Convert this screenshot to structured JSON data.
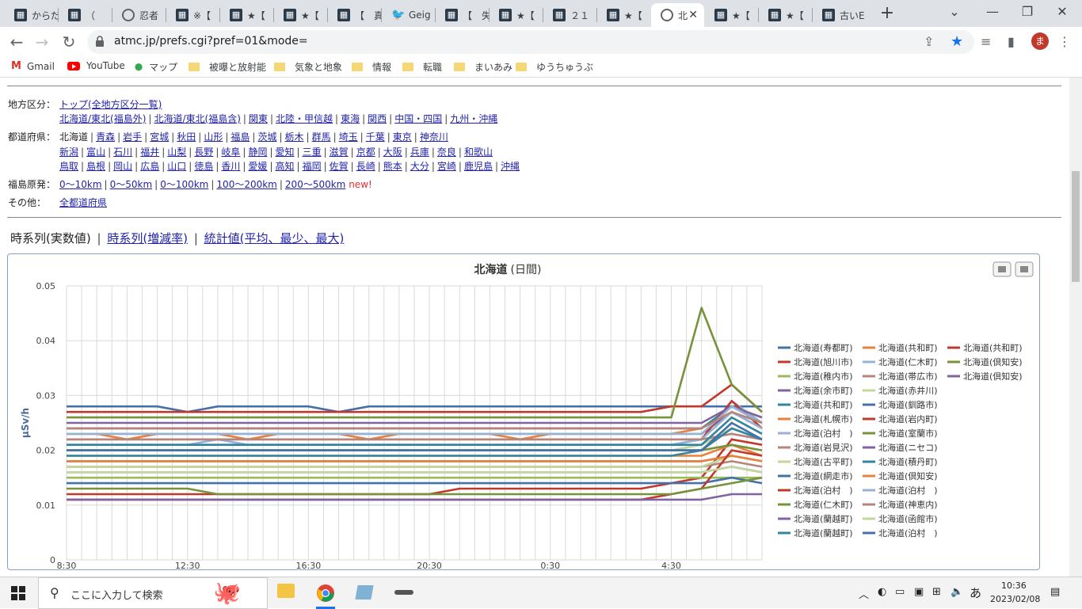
{
  "browser": {
    "tabs": [
      {
        "label": "からだ",
        "icon": "dark-favicon-icon"
      },
      {
        "label": "（",
        "icon": "dark-favicon-icon"
      },
      {
        "label": "忍者",
        "icon": "globe-icon"
      },
      {
        "label": "※【",
        "icon": "dark-favicon-icon"
      },
      {
        "label": "★【",
        "icon": "dark-favicon-icon"
      },
      {
        "label": "★【",
        "icon": "dark-favicon-icon"
      },
      {
        "label": "【　真",
        "icon": "dark-favicon-icon"
      },
      {
        "label": "Geig",
        "icon": "twitter-icon"
      },
      {
        "label": "【　失",
        "icon": "dark-favicon-icon"
      },
      {
        "label": "★【",
        "icon": "dark-favicon-icon"
      },
      {
        "label": "２１",
        "icon": "dark-favicon-icon"
      },
      {
        "label": "★【",
        "icon": "dark-favicon-icon"
      },
      {
        "label": "北",
        "icon": "globe-icon",
        "active": true
      },
      {
        "label": "★【",
        "icon": "dark-favicon-icon"
      },
      {
        "label": "★【",
        "icon": "dark-favicon-icon"
      },
      {
        "label": "古いE",
        "icon": "dark-favicon-icon"
      }
    ],
    "new_tab": "+",
    "url": "atmc.jp/prefs.cgi?pref=01&mode=",
    "avatar_letter": "ま",
    "bookmarks": [
      {
        "label": "Gmail",
        "type": "gmail"
      },
      {
        "label": "YouTube",
        "type": "youtube"
      },
      {
        "label": "マップ",
        "type": "maps"
      },
      {
        "label": "被曝と放射能",
        "type": "folder"
      },
      {
        "label": "気象と地象",
        "type": "folder"
      },
      {
        "label": "情報",
        "type": "folder"
      },
      {
        "label": "転職",
        "type": "folder"
      },
      {
        "label": "まいあみ",
        "type": "folder"
      },
      {
        "label": "ゆうちゅうぶ",
        "type": "folder"
      }
    ]
  },
  "nav": {
    "region_label": "地方区分：",
    "region_top": "トップ(全地方区分一覧)",
    "regions": [
      "北海道/東北(福島外)",
      "北海道/東北(福島含)",
      "関東",
      "北陸・甲信越",
      "東海",
      "関西",
      "中国・四国",
      "九州・沖縄"
    ],
    "pref_label": "都道府県：",
    "pref_current": "北海道",
    "prefs_row1": [
      "青森",
      "岩手",
      "宮城",
      "秋田",
      "山形",
      "福島",
      "茨城",
      "栃木",
      "群馬",
      "埼玉",
      "千葉",
      "東京",
      "神奈川"
    ],
    "prefs_row2": [
      "新潟",
      "富山",
      "石川",
      "福井",
      "山梨",
      "長野",
      "岐阜",
      "静岡",
      "愛知",
      "三重",
      "滋賀",
      "京都",
      "大阪",
      "兵庫",
      "奈良",
      "和歌山"
    ],
    "prefs_row3": [
      "鳥取",
      "島根",
      "岡山",
      "広島",
      "山口",
      "徳島",
      "香川",
      "愛媛",
      "高知",
      "福岡",
      "佐賀",
      "長崎",
      "熊本",
      "大分",
      "宮崎",
      "鹿児島",
      "沖縄"
    ],
    "fukushima_label": "福島原発：",
    "fukushima": [
      "0〜10km",
      "0〜50km",
      "0〜100km",
      "100〜200km",
      "200〜500km"
    ],
    "new_badge": "new!",
    "other_label": "その他：",
    "other_link": "全都道府県"
  },
  "view_tabs": {
    "current": "時系列(実数値)",
    "rate": "時系列(増減率)",
    "stats": "統計値(平均、最少、最大)"
  },
  "chart_data": {
    "type": "line",
    "title": "北海道 (日間)",
    "title_bold": "北海道",
    "title_rest": "(日間)",
    "ylabel": "μSv/h",
    "xlabel": "",
    "ylim": [
      0,
      0.05
    ],
    "yticks": [
      "0",
      "0.01",
      "0.02",
      "0.03",
      "0.04",
      "0.05"
    ],
    "xticks": [
      "8:30",
      "12:30",
      "16:30",
      "20:30",
      "0:30",
      "4:30"
    ],
    "grid": true,
    "legend_position": "right",
    "x": [
      "8:30",
      "9:30",
      "10:30",
      "11:30",
      "12:30",
      "13:30",
      "14:30",
      "15:30",
      "16:30",
      "17:30",
      "18:30",
      "19:30",
      "20:30",
      "21:30",
      "22:30",
      "23:30",
      "0:30",
      "1:30",
      "2:30",
      "3:30",
      "4:30",
      "5:30",
      "6:30",
      "7:30"
    ],
    "series": [
      {
        "name": "北海道(寿都町)",
        "color": "#4472a8",
        "values": [
          0.028,
          0.028,
          0.028,
          0.028,
          0.027,
          0.028,
          0.028,
          0.028,
          0.028,
          0.027,
          0.028,
          0.028,
          0.028,
          0.028,
          0.028,
          0.028,
          0.028,
          0.028,
          0.028,
          0.028,
          0.028,
          0.028,
          0.028,
          0.028
        ]
      },
      {
        "name": "北海道(共和町)",
        "color": "#e8823a",
        "values": [
          0.023,
          0.023,
          0.022,
          0.023,
          0.023,
          0.023,
          0.022,
          0.023,
          0.023,
          0.023,
          0.022,
          0.023,
          0.023,
          0.023,
          0.023,
          0.022,
          0.023,
          0.023,
          0.023,
          0.023,
          0.023,
          0.024,
          0.028,
          0.026
        ]
      },
      {
        "name": "北海道(共和町)",
        "color": "#c0392b",
        "values": [
          0.027,
          0.027,
          0.027,
          0.027,
          0.027,
          0.027,
          0.027,
          0.027,
          0.027,
          0.027,
          0.027,
          0.027,
          0.027,
          0.027,
          0.027,
          0.027,
          0.027,
          0.027,
          0.027,
          0.027,
          0.028,
          0.028,
          0.032,
          0.027
        ]
      },
      {
        "name": "北海道(旭川市)",
        "color": "#c0392b",
        "values": [
          0.012,
          0.012,
          0.012,
          0.012,
          0.012,
          0.012,
          0.012,
          0.012,
          0.012,
          0.012,
          0.012,
          0.012,
          0.012,
          0.013,
          0.013,
          0.013,
          0.013,
          0.013,
          0.013,
          0.013,
          0.014,
          0.015,
          0.022,
          0.021
        ]
      },
      {
        "name": "北海道(仁木町)",
        "color": "#95b3d7",
        "values": [
          0.021,
          0.021,
          0.021,
          0.021,
          0.021,
          0.022,
          0.021,
          0.021,
          0.021,
          0.021,
          0.021,
          0.021,
          0.021,
          0.021,
          0.021,
          0.021,
          0.021,
          0.021,
          0.021,
          0.021,
          0.021,
          0.022,
          0.029,
          0.025
        ]
      },
      {
        "name": "北海道(倶知安)",
        "color": "#76933c",
        "values": [
          0.026,
          0.026,
          0.026,
          0.026,
          0.026,
          0.026,
          0.026,
          0.026,
          0.026,
          0.026,
          0.026,
          0.026,
          0.026,
          0.026,
          0.026,
          0.026,
          0.026,
          0.026,
          0.026,
          0.026,
          0.026,
          0.046,
          0.032,
          0.027
        ]
      },
      {
        "name": "北海道(稚内市)",
        "color": "#9bbb59",
        "values": [
          0.015,
          0.015,
          0.015,
          0.015,
          0.015,
          0.015,
          0.015,
          0.015,
          0.015,
          0.015,
          0.015,
          0.015,
          0.015,
          0.015,
          0.015,
          0.015,
          0.015,
          0.015,
          0.015,
          0.015,
          0.015,
          0.015,
          0.015,
          0.015
        ]
      },
      {
        "name": "北海道(帯広市)",
        "color": "#b7847c",
        "values": [
          0.017,
          0.017,
          0.017,
          0.017,
          0.017,
          0.017,
          0.017,
          0.017,
          0.017,
          0.017,
          0.017,
          0.017,
          0.017,
          0.017,
          0.017,
          0.017,
          0.017,
          0.017,
          0.017,
          0.017,
          0.017,
          0.017,
          0.018,
          0.017
        ]
      },
      {
        "name": "北海道(倶知安)",
        "color": "#8064a2",
        "values": [
          0.023,
          0.023,
          0.023,
          0.023,
          0.023,
          0.023,
          0.023,
          0.023,
          0.023,
          0.023,
          0.023,
          0.023,
          0.023,
          0.023,
          0.023,
          0.023,
          0.023,
          0.023,
          0.023,
          0.023,
          0.023,
          0.023,
          0.027,
          0.024
        ]
      },
      {
        "name": "北海道(余市町)",
        "color": "#8064a2",
        "values": [
          0.018,
          0.018,
          0.018,
          0.018,
          0.018,
          0.018,
          0.018,
          0.018,
          0.018,
          0.018,
          0.018,
          0.018,
          0.018,
          0.018,
          0.018,
          0.018,
          0.018,
          0.018,
          0.018,
          0.018,
          0.018,
          0.018,
          0.019,
          0.018
        ]
      },
      {
        "name": "北海道(赤井川)",
        "color": "#c4d79b",
        "values": [
          0.02,
          0.02,
          0.02,
          0.02,
          0.02,
          0.02,
          0.02,
          0.02,
          0.02,
          0.02,
          0.02,
          0.02,
          0.02,
          0.02,
          0.02,
          0.02,
          0.02,
          0.02,
          0.02,
          0.02,
          0.02,
          0.021,
          0.024,
          0.022
        ]
      },
      {
        "name": "北海道(共和町)",
        "color": "#31859c",
        "values": [
          0.024,
          0.024,
          0.024,
          0.024,
          0.024,
          0.024,
          0.024,
          0.024,
          0.024,
          0.024,
          0.024,
          0.024,
          0.024,
          0.024,
          0.024,
          0.024,
          0.024,
          0.024,
          0.024,
          0.024,
          0.024,
          0.024,
          0.028,
          0.025
        ]
      },
      {
        "name": "北海道(釧路市)",
        "color": "#4472a8",
        "values": [
          0.014,
          0.014,
          0.014,
          0.014,
          0.014,
          0.014,
          0.014,
          0.014,
          0.014,
          0.014,
          0.014,
          0.014,
          0.014,
          0.014,
          0.014,
          0.014,
          0.014,
          0.014,
          0.014,
          0.014,
          0.014,
          0.014,
          0.015,
          0.014
        ]
      },
      {
        "name": "北海道(札幌市)",
        "color": "#e8823a",
        "values": [
          0.019,
          0.019,
          0.019,
          0.019,
          0.019,
          0.019,
          0.019,
          0.019,
          0.019,
          0.019,
          0.019,
          0.019,
          0.019,
          0.019,
          0.019,
          0.019,
          0.019,
          0.019,
          0.019,
          0.019,
          0.019,
          0.019,
          0.021,
          0.019
        ]
      },
      {
        "name": "北海道(岩内町)",
        "color": "#c0392b",
        "values": [
          0.022,
          0.022,
          0.022,
          0.022,
          0.022,
          0.022,
          0.022,
          0.022,
          0.022,
          0.022,
          0.022,
          0.022,
          0.022,
          0.022,
          0.022,
          0.022,
          0.022,
          0.022,
          0.022,
          0.022,
          0.022,
          0.022,
          0.029,
          0.024
        ]
      },
      {
        "name": "北海道(泊村　)",
        "color": "#95b3d7",
        "values": [
          0.021,
          0.021,
          0.021,
          0.021,
          0.021,
          0.021,
          0.021,
          0.021,
          0.021,
          0.021,
          0.021,
          0.021,
          0.021,
          0.021,
          0.021,
          0.021,
          0.021,
          0.021,
          0.021,
          0.021,
          0.021,
          0.022,
          0.027,
          0.024
        ]
      },
      {
        "name": "北海道(室蘭市)",
        "color": "#76933c",
        "values": [
          0.02,
          0.02,
          0.02,
          0.02,
          0.02,
          0.02,
          0.02,
          0.02,
          0.02,
          0.02,
          0.02,
          0.02,
          0.02,
          0.02,
          0.02,
          0.02,
          0.02,
          0.02,
          0.02,
          0.02,
          0.02,
          0.02,
          0.021,
          0.02
        ]
      },
      {
        "name": "北海道(岩見沢)",
        "color": "#b7847c",
        "values": [
          0.022,
          0.022,
          0.022,
          0.022,
          0.022,
          0.022,
          0.022,
          0.022,
          0.022,
          0.022,
          0.022,
          0.022,
          0.022,
          0.022,
          0.022,
          0.022,
          0.022,
          0.022,
          0.022,
          0.022,
          0.022,
          0.022,
          0.023,
          0.022
        ]
      },
      {
        "name": "北海道(ニセコ)",
        "color": "#8064a2",
        "values": [
          0.025,
          0.025,
          0.025,
          0.025,
          0.025,
          0.025,
          0.025,
          0.025,
          0.025,
          0.025,
          0.025,
          0.025,
          0.025,
          0.025,
          0.025,
          0.025,
          0.025,
          0.025,
          0.025,
          0.025,
          0.025,
          0.025,
          0.028,
          0.026
        ]
      },
      {
        "name": "北海道(古平町)",
        "color": "#c4d79b",
        "values": [
          0.017,
          0.017,
          0.017,
          0.017,
          0.017,
          0.017,
          0.017,
          0.017,
          0.017,
          0.017,
          0.017,
          0.017,
          0.017,
          0.017,
          0.017,
          0.017,
          0.017,
          0.017,
          0.017,
          0.017,
          0.017,
          0.017,
          0.019,
          0.018
        ]
      },
      {
        "name": "北海道(積丹町)",
        "color": "#31859c",
        "values": [
          0.021,
          0.021,
          0.021,
          0.021,
          0.021,
          0.021,
          0.021,
          0.021,
          0.021,
          0.021,
          0.021,
          0.021,
          0.021,
          0.021,
          0.021,
          0.021,
          0.021,
          0.021,
          0.021,
          0.021,
          0.021,
          0.021,
          0.026,
          0.023
        ]
      },
      {
        "name": "北海道(網走市)",
        "color": "#4472a8",
        "values": [
          0.016,
          0.016,
          0.016,
          0.016,
          0.016,
          0.016,
          0.016,
          0.016,
          0.016,
          0.016,
          0.016,
          0.016,
          0.016,
          0.016,
          0.016,
          0.016,
          0.016,
          0.016,
          0.016,
          0.016,
          0.016,
          0.016,
          0.017,
          0.016
        ]
      },
      {
        "name": "北海道(倶知安)",
        "color": "#e8823a",
        "values": [
          0.018,
          0.018,
          0.018,
          0.018,
          0.018,
          0.018,
          0.018,
          0.018,
          0.018,
          0.018,
          0.018,
          0.018,
          0.018,
          0.018,
          0.018,
          0.018,
          0.018,
          0.018,
          0.018,
          0.018,
          0.018,
          0.018,
          0.019,
          0.018
        ]
      },
      {
        "name": "北海道(泊村　)",
        "color": "#c0392b",
        "values": [
          0.011,
          0.011,
          0.011,
          0.011,
          0.011,
          0.011,
          0.011,
          0.011,
          0.011,
          0.011,
          0.011,
          0.011,
          0.011,
          0.011,
          0.011,
          0.011,
          0.011,
          0.011,
          0.011,
          0.011,
          0.012,
          0.013,
          0.02,
          0.019
        ]
      },
      {
        "name": "北海道(泊村　)",
        "color": "#95b3d7",
        "values": [
          0.023,
          0.023,
          0.023,
          0.023,
          0.023,
          0.023,
          0.023,
          0.023,
          0.023,
          0.023,
          0.023,
          0.023,
          0.023,
          0.023,
          0.023,
          0.023,
          0.023,
          0.023,
          0.023,
          0.023,
          0.023,
          0.023,
          0.028,
          0.025
        ]
      },
      {
        "name": "北海道(仁木町)",
        "color": "#76933c",
        "values": [
          0.013,
          0.013,
          0.013,
          0.013,
          0.013,
          0.012,
          0.012,
          0.012,
          0.012,
          0.012,
          0.012,
          0.012,
          0.012,
          0.012,
          0.012,
          0.012,
          0.012,
          0.012,
          0.012,
          0.012,
          0.012,
          0.013,
          0.014,
          0.015
        ]
      },
      {
        "name": "北海道(神恵内)",
        "color": "#b7847c",
        "values": [
          0.024,
          0.024,
          0.024,
          0.024,
          0.024,
          0.024,
          0.024,
          0.024,
          0.024,
          0.024,
          0.024,
          0.024,
          0.024,
          0.024,
          0.024,
          0.024,
          0.024,
          0.024,
          0.024,
          0.024,
          0.024,
          0.024,
          0.027,
          0.025
        ]
      },
      {
        "name": "北海道(蘭越町)",
        "color": "#8064a2",
        "values": [
          0.011,
          0.011,
          0.011,
          0.011,
          0.011,
          0.011,
          0.011,
          0.011,
          0.011,
          0.011,
          0.011,
          0.011,
          0.011,
          0.011,
          0.011,
          0.011,
          0.011,
          0.011,
          0.011,
          0.011,
          0.011,
          0.011,
          0.012,
          0.012
        ]
      },
      {
        "name": "北海道(函館市)",
        "color": "#c4d79b",
        "values": [
          0.016,
          0.016,
          0.016,
          0.016,
          0.016,
          0.016,
          0.016,
          0.016,
          0.016,
          0.016,
          0.016,
          0.016,
          0.016,
          0.016,
          0.016,
          0.016,
          0.016,
          0.016,
          0.016,
          0.016,
          0.016,
          0.016,
          0.017,
          0.016
        ]
      },
      {
        "name": "北海道(蘭越町)",
        "color": "#31859c",
        "values": [
          0.019,
          0.019,
          0.019,
          0.019,
          0.019,
          0.019,
          0.019,
          0.019,
          0.019,
          0.019,
          0.019,
          0.019,
          0.019,
          0.019,
          0.019,
          0.019,
          0.019,
          0.019,
          0.019,
          0.019,
          0.019,
          0.02,
          0.024,
          0.022
        ]
      },
      {
        "name": "北海道(泊村　)",
        "color": "#4472a8",
        "values": [
          0.02,
          0.02,
          0.02,
          0.02,
          0.02,
          0.02,
          0.02,
          0.02,
          0.02,
          0.02,
          0.02,
          0.02,
          0.02,
          0.02,
          0.02,
          0.02,
          0.02,
          0.02,
          0.02,
          0.02,
          0.02,
          0.02,
          0.025,
          0.022
        ]
      }
    ]
  },
  "taskbar": {
    "search_placeholder": "ここに入力して検索",
    "ime": "あ",
    "time": "10:36",
    "date": "2023/02/08"
  }
}
